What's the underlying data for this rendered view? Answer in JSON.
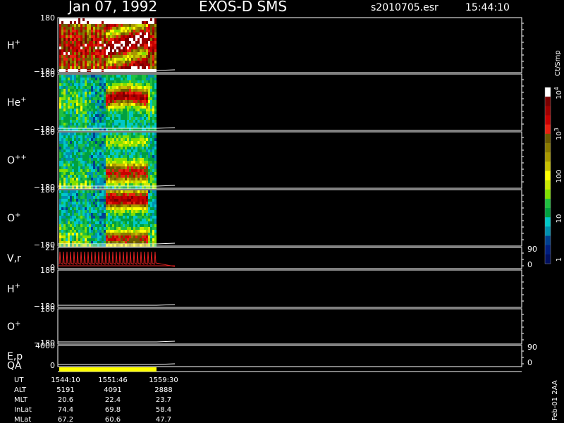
{
  "header": {
    "date": "Jan 07, 1992",
    "instrument": "EXOS-D SMS",
    "file": "s2010705.esr",
    "time": "15:44:10"
  },
  "panels": [
    {
      "label": "H",
      "sup": "+",
      "top": "180",
      "bottom": "−180",
      "spectro": true,
      "pattern": "h"
    },
    {
      "label": "He",
      "sup": "+",
      "top": "180",
      "bottom": "−180",
      "spectro": true,
      "pattern": "he"
    },
    {
      "label": "O",
      "sup": "++",
      "top": "180",
      "bottom": "−180",
      "spectro": true,
      "pattern": "opp"
    },
    {
      "label": "O",
      "sup": "+",
      "top": "180",
      "bottom": "−180",
      "spectro": true,
      "pattern": "op"
    },
    {
      "label": "V,r",
      "sup": "",
      "top": "25",
      "bottom": "0",
      "right_top": "90",
      "right_bottom": "0",
      "spectro": false
    },
    {
      "label": "H",
      "sup": "+",
      "top": "180",
      "bottom": "−180",
      "spectro": false
    },
    {
      "label": "O",
      "sup": "+",
      "top": "180",
      "bottom": "−180",
      "spectro": false
    },
    {
      "label": "E,p",
      "sup": "",
      "top": "4000",
      "bottom": "0",
      "right_top": "90",
      "right_bottom": "0",
      "spectro": false
    }
  ],
  "qa_label": "QA",
  "colorbar": {
    "unit": "Ct/Smp",
    "ticks": [
      "10",
      "10",
      "100",
      "10",
      "1"
    ],
    "tick_exps": [
      "4",
      "3",
      "",
      "",
      ""
    ],
    "colors": [
      "#ffffff",
      "#7a0000",
      "#a00000",
      "#c80000",
      "#e82010",
      "#6b5a00",
      "#8a7a00",
      "#a89800",
      "#c8c000",
      "#ffff00",
      "#c8e800",
      "#80e000",
      "#20c040",
      "#00a040",
      "#00c8c8",
      "#0090b0",
      "#004090",
      "#001f80",
      "#001060"
    ]
  },
  "ephemeris": {
    "rows": [
      {
        "name": "UT",
        "values": [
          "1544:10",
          "1551:46",
          "1559:30"
        ]
      },
      {
        "name": "ALT",
        "values": [
          "5191",
          "4091",
          "2888"
        ]
      },
      {
        "name": "MLT",
        "values": [
          "20.6",
          "22.4",
          "23.7"
        ]
      },
      {
        "name": "InLat",
        "values": [
          "74.4",
          "69.8",
          "58.4"
        ]
      },
      {
        "name": "MLat",
        "values": [
          "67.2",
          "60.6",
          "47.7"
        ]
      }
    ]
  },
  "footer_id": "Feb-01 2AA",
  "chart_data": {
    "type": "heatmap",
    "title": "Jan 07, 1992   EXOS-D SMS",
    "x": [
      "1544:10",
      "1551:46",
      "1559:30"
    ],
    "y_range": [
      -180,
      180
    ],
    "colorbar_label": "Ct/Smp",
    "colorbar_range": [
      1,
      10000
    ],
    "colorbar_scale": "log"
  }
}
